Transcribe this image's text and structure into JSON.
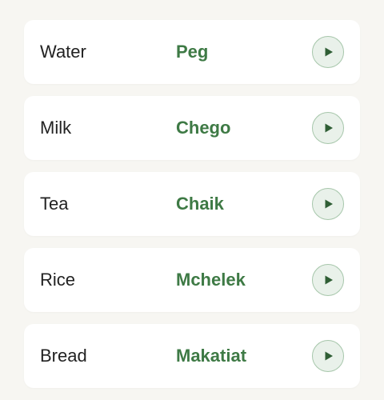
{
  "items": [
    {
      "word": "Water",
      "translation": "Peg",
      "icon": "play-icon"
    },
    {
      "word": "Milk",
      "translation": "Chego",
      "icon": "play-icon"
    },
    {
      "word": "Tea",
      "translation": "Chaik",
      "icon": "play-icon"
    },
    {
      "word": "Rice",
      "translation": "Mchelek",
      "icon": "play-icon"
    },
    {
      "word": "Bread",
      "translation": "Makatiat",
      "icon": "play-icon"
    }
  ],
  "colors": {
    "background": "#f7f6f2",
    "card": "#ffffff",
    "word_text": "#222222",
    "translation_text": "#3e7a45",
    "button_fill": "#e9f1ea",
    "button_border": "#a6c6aa",
    "icon": "#2f5e35"
  }
}
